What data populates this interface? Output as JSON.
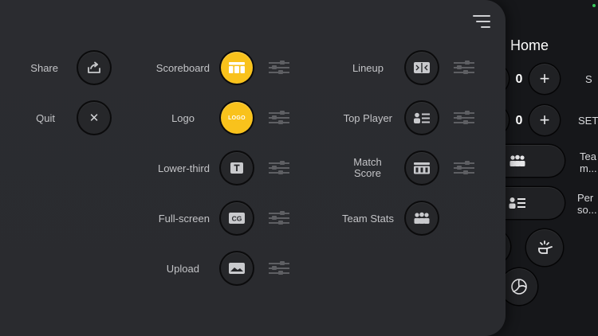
{
  "background": {
    "home_title": "Home",
    "row1": {
      "score": "0",
      "plus": "+",
      "label": "S"
    },
    "row2": {
      "score": "0",
      "plus": "+",
      "label": "SET"
    },
    "team_label": "Tea\nm...",
    "per_label": "Per\nso..."
  },
  "menu": {
    "col1": [
      {
        "label": "Share"
      },
      {
        "label": "Quit",
        "glyph": "✕"
      }
    ],
    "col2": [
      {
        "label": "Scoreboard"
      },
      {
        "label": "Logo",
        "logo_text": "LOGO"
      },
      {
        "label": "Lower-third"
      },
      {
        "label": "Full-screen"
      },
      {
        "label": "Upload"
      }
    ],
    "col3": [
      {
        "label": "Lineup"
      },
      {
        "label": "Top Player"
      },
      {
        "label": "Match Score",
        "label_line1": "Match",
        "label_line2": "Score"
      },
      {
        "label": "Team Stats"
      }
    ]
  },
  "colors": {
    "accent": "#f9c21c",
    "panel": "#2b2c30",
    "background": "#16171a"
  }
}
